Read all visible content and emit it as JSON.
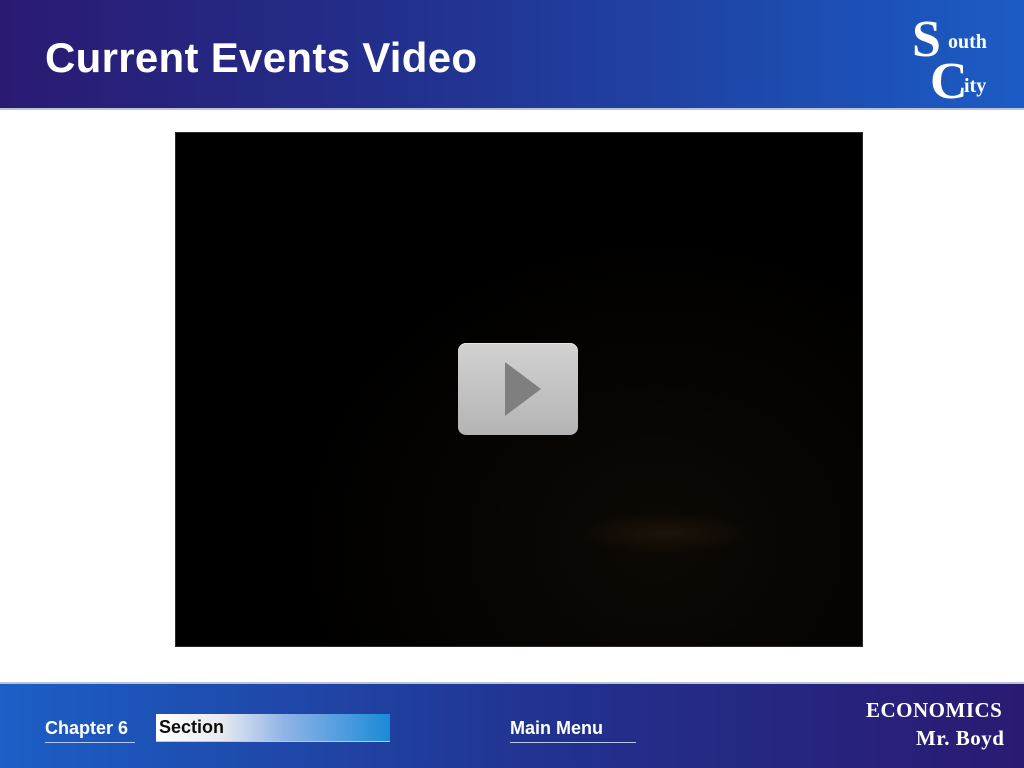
{
  "header": {
    "title": "Current Events Video",
    "logo": {
      "letter_s": "S",
      "rest_s": "outh",
      "letter_c": "C",
      "rest_c": "ity"
    }
  },
  "video": {
    "play_icon": "play-icon"
  },
  "footer": {
    "chapter_label": "Chapter 6",
    "section_label": "Section",
    "main_menu_label": "Main Menu",
    "brand_subject": "ECONOMICS",
    "brand_teacher": "Mr. Boyd"
  },
  "colors": {
    "header_dark": "#2a1a72",
    "header_light": "#1b5cc4",
    "video_bg": "#000000",
    "play_button": "#c4c4c4",
    "play_triangle": "#7f7f7f"
  }
}
